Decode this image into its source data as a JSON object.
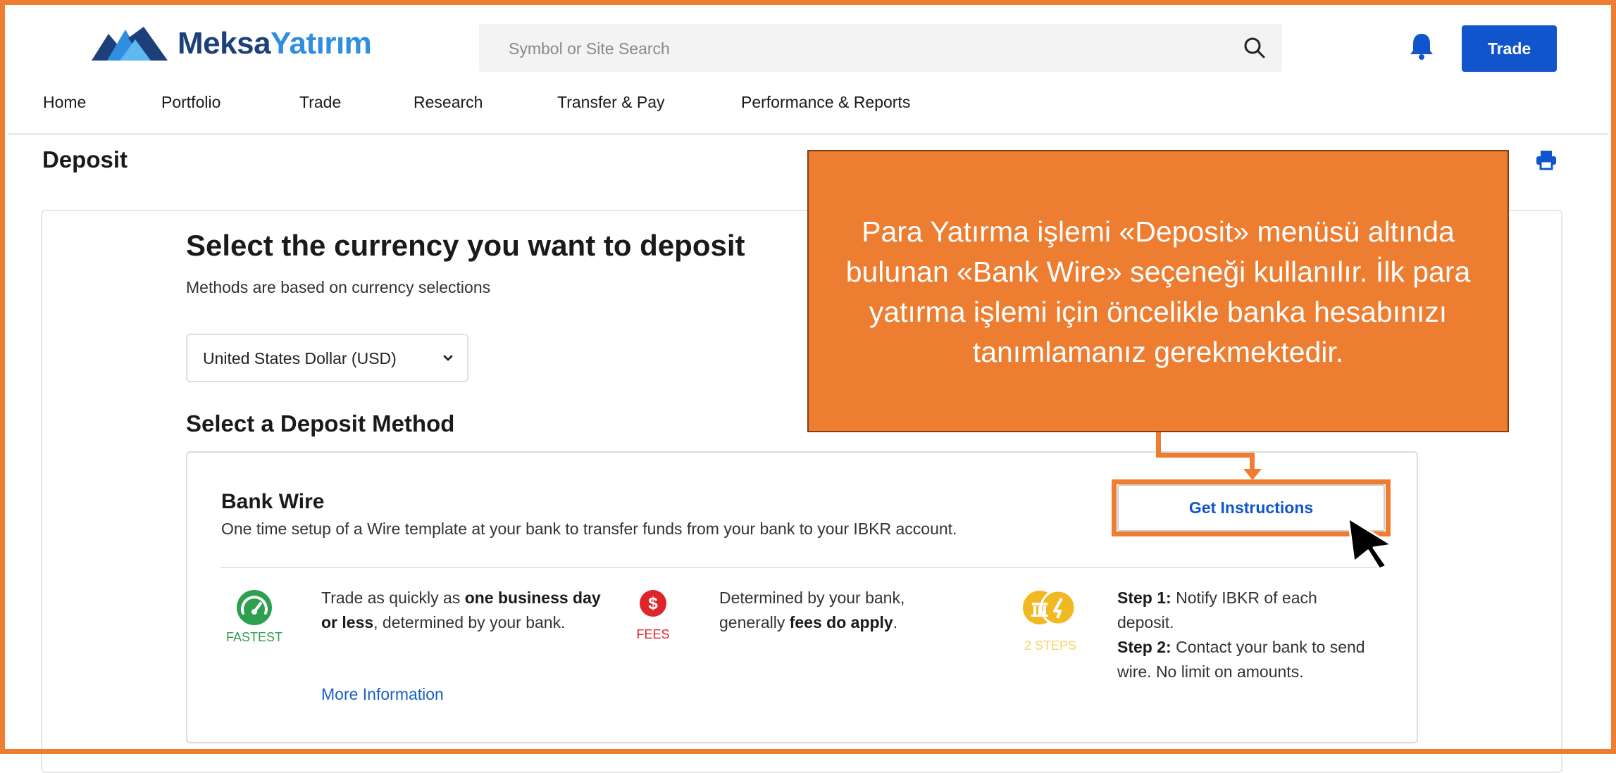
{
  "header": {
    "brand_part1": "Meksa",
    "brand_part2": "Yatırım",
    "search_placeholder": "Symbol or Site Search",
    "trade_button": "Trade"
  },
  "nav": {
    "items": [
      "Home",
      "Portfolio",
      "Trade",
      "Research",
      "Transfer & Pay",
      "Performance & Reports"
    ]
  },
  "page": {
    "title": "Deposit",
    "select_heading": "Select the currency you want to deposit",
    "select_sub": "Methods are based on currency selections",
    "currency_selected": "United States Dollar (USD)",
    "method_heading": "Select a Deposit Method"
  },
  "method": {
    "title": "Bank Wire",
    "description": "One time setup of a Wire template at your bank to transfer funds from your bank to your IBKR account.",
    "button": "Get Instructions",
    "more_info": "More Information",
    "features": {
      "speed": {
        "label": "FASTEST",
        "text_a": "Trade as quickly as ",
        "text_b": "one business day or less",
        "text_c": ", determined by your bank."
      },
      "fees": {
        "label": "FEES",
        "text_a": "Determined by your bank, generally ",
        "text_b": "fees do apply",
        "text_c": "."
      },
      "steps": {
        "label": "2 STEPS",
        "step1_label": "Step 1:",
        "step1_text": " Notify IBKR of each deposit.",
        "step2_label": "Step 2:",
        "step2_text": " Contact your bank to send wire. No limit on amounts."
      }
    }
  },
  "callout": {
    "text": "Para Yatırma işlemi «Deposit» menüsü altında bulunan «Bank Wire» seçeneği kullanılır. İlk para yatırma işlemi için öncelikle banka hesabınızı tanımlamanız gerekmektedir."
  },
  "colors": {
    "accent_orange": "#ED7D31",
    "brand_blue": "#1155cc",
    "fastest_green": "#2e9e4f",
    "fees_red": "#e0242c",
    "steps_yellow": "#f2b822"
  }
}
